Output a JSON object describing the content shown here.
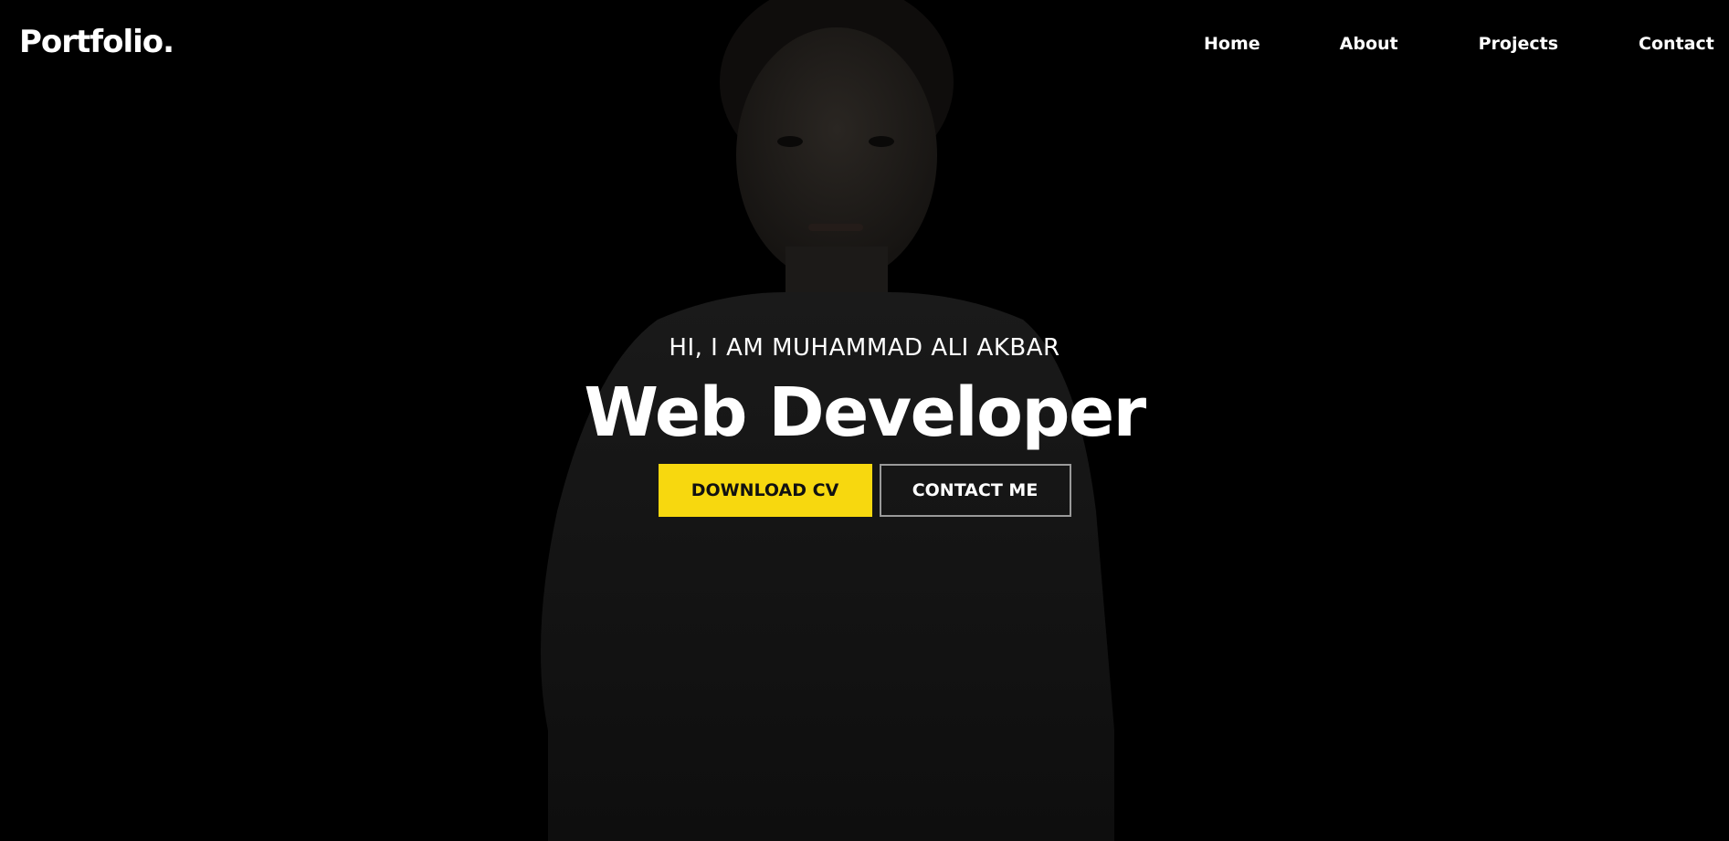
{
  "navbar": {
    "logo": "Portfolio.",
    "links": [
      {
        "label": "Home"
      },
      {
        "label": "About"
      },
      {
        "label": "Projects"
      },
      {
        "label": "Contact"
      }
    ]
  },
  "hero": {
    "greeting": "HI, I AM MUHAMMAD ALI AKBAR",
    "title": "Web Developer",
    "buttons": {
      "download_cv": "DOWNLOAD CV",
      "contact_me": "CONTACT ME"
    }
  },
  "colors": {
    "background": "#000000",
    "text": "#ffffff",
    "accent": "#f7d80f",
    "outline": "#9a9a9a"
  }
}
